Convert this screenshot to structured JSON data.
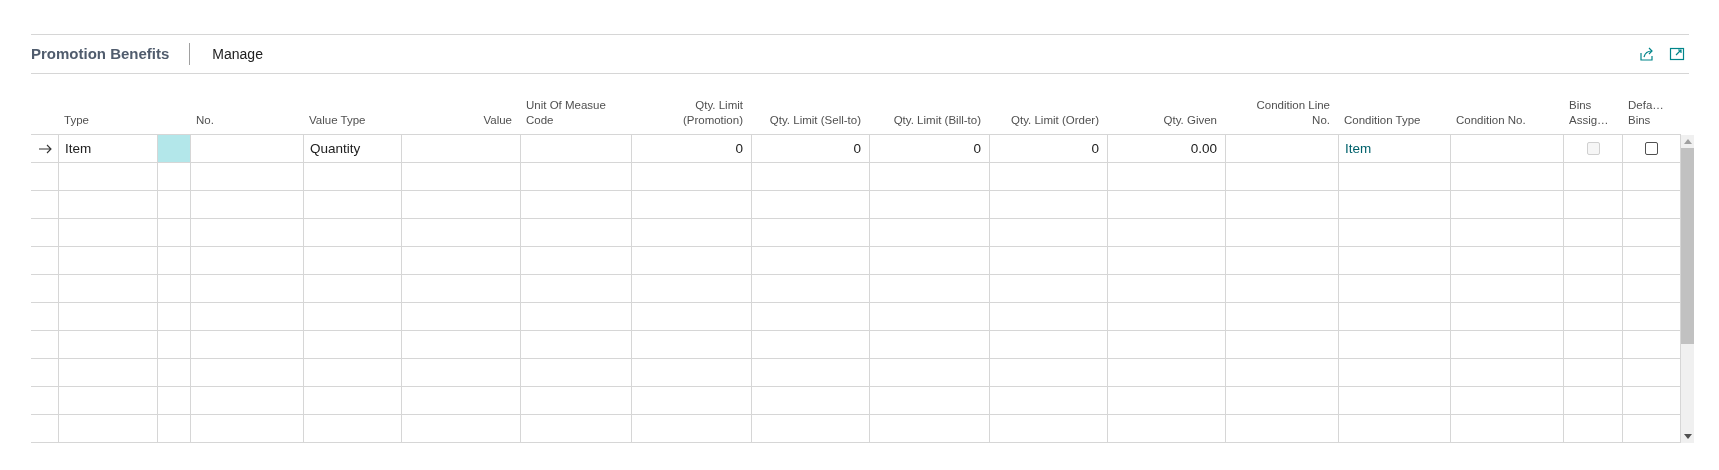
{
  "part_title": "Promotion Benefits",
  "actions": [
    {
      "label": "Manage"
    }
  ],
  "columns": [
    {
      "kind": "text",
      "label": "Type"
    },
    {
      "kind": "spacer"
    },
    {
      "kind": "text",
      "label": "No."
    },
    {
      "kind": "text",
      "label": "Value Type"
    },
    {
      "kind": "number",
      "label": "Value"
    },
    {
      "kind": "text",
      "label": "Unit Of Measue\nCode"
    },
    {
      "kind": "number",
      "label": "Qty. Limit\n(Promotion)"
    },
    {
      "kind": "number",
      "label": "Qty. Limit (Sell-to)"
    },
    {
      "kind": "number",
      "label": "Qty. Limit (Bill-to)"
    },
    {
      "kind": "number",
      "label": "Qty. Limit (Order)"
    },
    {
      "kind": "number",
      "label": "Qty. Given"
    },
    {
      "kind": "number",
      "label": "Condition Line\nNo."
    },
    {
      "kind": "text",
      "label": "Condition Type"
    },
    {
      "kind": "text",
      "label": "Condition No."
    },
    {
      "kind": "text",
      "label": "Bins\nAssig…"
    },
    {
      "kind": "text",
      "label": "Defa…\nBins"
    }
  ],
  "rows": [
    {
      "current": true,
      "cells": [
        {
          "kind": "text",
          "text": "Item"
        },
        {
          "kind": "focus",
          "selected": true
        },
        {
          "kind": "blank"
        },
        {
          "kind": "text",
          "text": "Quantity"
        },
        {
          "kind": "blank"
        },
        {
          "kind": "blank"
        },
        {
          "kind": "number",
          "text": "0"
        },
        {
          "kind": "number",
          "text": "0"
        },
        {
          "kind": "number",
          "text": "0"
        },
        {
          "kind": "number",
          "text": "0"
        },
        {
          "kind": "number",
          "text": "0.00"
        },
        {
          "kind": "blank"
        },
        {
          "kind": "link",
          "text": "Item"
        },
        {
          "kind": "blank"
        },
        {
          "kind": "checkbox",
          "checked": false,
          "disabled": true
        },
        {
          "kind": "checkbox",
          "checked": false,
          "disabled": false
        }
      ]
    }
  ]
}
